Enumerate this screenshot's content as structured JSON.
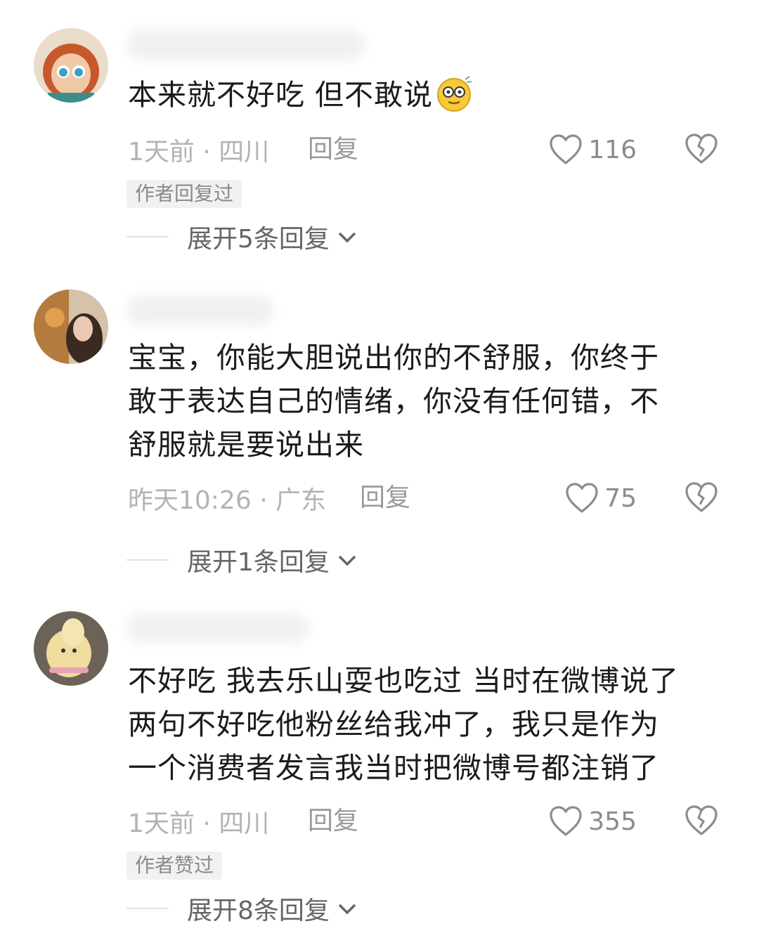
{
  "comments": [
    {
      "text": "本来就不好吃 但不敢说",
      "time": "1天前 · 四川",
      "reply_label": "回复",
      "likes": "116",
      "badge": "作者回复过",
      "expand_label": "展开5条回复",
      "emoji": "dizzy-face-emoji"
    },
    {
      "text": "宝宝，你能大胆说出你的不舒服，你终于\n敢于表达自己的情绪，你没有任何错，不\n舒服就是要说出来",
      "time": "昨天10:26 · 广东",
      "reply_label": "回复",
      "likes": "75",
      "expand_label": "展开1条回复"
    },
    {
      "text": "不好吃 我去乐山耍也吃过 当时在微博说了\n两句不好吃他粉丝给我冲了，我只是作为\n一个消费者发言我当时把微博号都注销了",
      "time": "1天前 · 四川",
      "reply_label": "回复",
      "likes": "355",
      "badge": "作者赞过",
      "expand_label": "展开8条回复"
    }
  ],
  "icons": {
    "like": "heart-outline-icon",
    "dislike": "broken-heart-icon",
    "expand": "chevron-down-icon"
  },
  "colors": {
    "text": "#1b1b1b",
    "meta": "#b3b3b3",
    "badge_bg": "#f1f1f1"
  }
}
